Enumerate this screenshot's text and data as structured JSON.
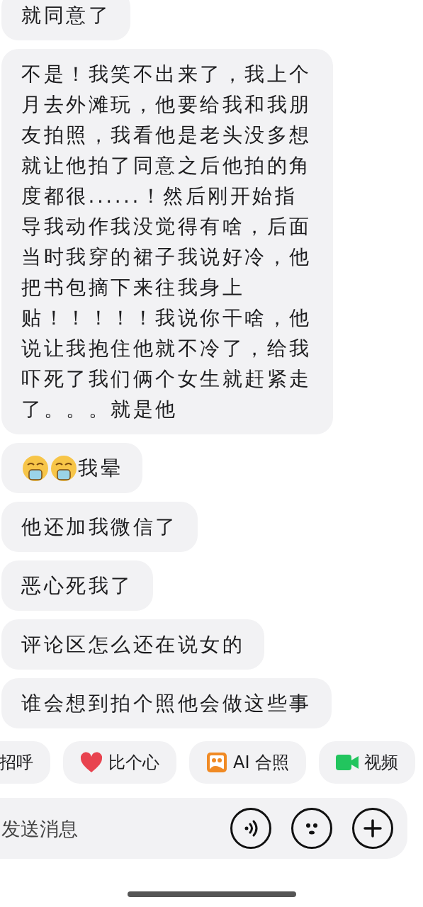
{
  "messages": [
    {
      "kind": "text",
      "text": "就同意了"
    },
    {
      "kind": "text",
      "text": "不是！我笑不出来了，我上个月去外滩玩，他要给我和我朋友拍照，我看他是老头没多想就让他拍了同意之后他拍的角度都很......！然后刚开始指导我动作我没觉得有啥，后面当时我穿的裙子我说好冷，他把书包摘下来往我身上贴！！！！！我说你干啥，他说让我抱住他就不冷了，给我吓死了我们俩个女生就赶紧走了。。。就是他"
    },
    {
      "kind": "emoji-text",
      "text": "我晕"
    },
    {
      "kind": "text",
      "text": "他还加我微信了"
    },
    {
      "kind": "text",
      "text": "恶心死我了"
    },
    {
      "kind": "text",
      "text": "评论区怎么还在说女的"
    },
    {
      "kind": "text",
      "text": "谁会想到拍个照他会做这些事"
    }
  ],
  "quick_actions": [
    {
      "kind": "plain",
      "label": "招呼"
    },
    {
      "kind": "heart",
      "label": "比个心"
    },
    {
      "kind": "photo",
      "label": "AI 合照"
    },
    {
      "kind": "video",
      "label": "视频"
    }
  ],
  "composer": {
    "placeholder": "发送消息"
  }
}
